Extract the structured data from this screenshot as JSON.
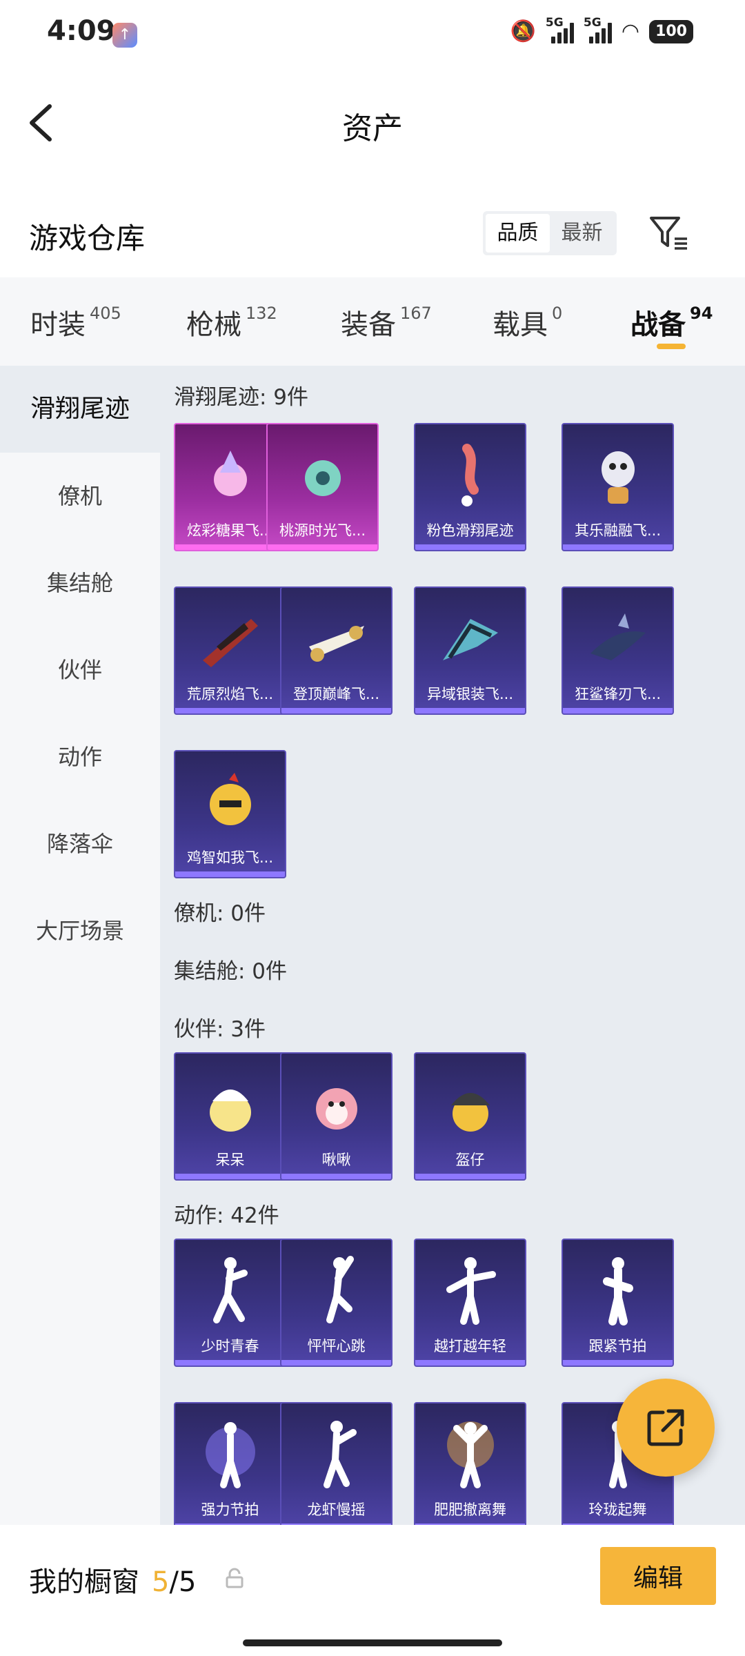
{
  "status": {
    "time": "4:09",
    "battery": "100",
    "sig1": "5G",
    "sig2": "5G"
  },
  "header": {
    "title": "资产"
  },
  "warehouse": {
    "title": "游戏仓库",
    "sort_options": [
      "品质",
      "最新"
    ],
    "sort_active": "品质"
  },
  "tabs": [
    {
      "label": "时装",
      "count": "405"
    },
    {
      "label": "枪械",
      "count": "132"
    },
    {
      "label": "装备",
      "count": "167"
    },
    {
      "label": "载具",
      "count": "0"
    },
    {
      "label": "战备",
      "count": "94"
    }
  ],
  "sidebar": [
    "滑翔尾迹",
    "僚机",
    "集结舱",
    "伙伴",
    "动作",
    "降落伞",
    "大厅场景"
  ],
  "sections": {
    "glide": {
      "title": "滑翔尾迹: 9件",
      "items": [
        "炫彩糖果飞...",
        "桃源时光飞...",
        "粉色滑翔尾迹",
        "其乐融融飞...",
        "荒原烈焰飞...",
        "登顶巅峰飞...",
        "异域银装飞...",
        "狂鲨锋刃飞...",
        "鸡智如我飞..."
      ]
    },
    "wingman": {
      "title": "僚机: 0件"
    },
    "pod": {
      "title": "集结舱: 0件"
    },
    "partner": {
      "title": "伙伴: 3件",
      "items": [
        "呆呆",
        "啾啾",
        "盔仔"
      ]
    },
    "action": {
      "title": "动作: 42件",
      "items": [
        "少时青春",
        "怦怦心跳",
        "越打越年轻",
        "跟紧节拍",
        "强力节拍",
        "龙虾慢摇",
        "肥肥撤离舞",
        "玲珑起舞"
      ]
    }
  },
  "bottom": {
    "label": "我的橱窗",
    "count": "5",
    "sep": "/",
    "total": "5",
    "edit": "编辑"
  },
  "colors": {
    "accent": "#f6b53a",
    "card_purple": "#3c3588",
    "card_pink": "#9b2ea0"
  }
}
